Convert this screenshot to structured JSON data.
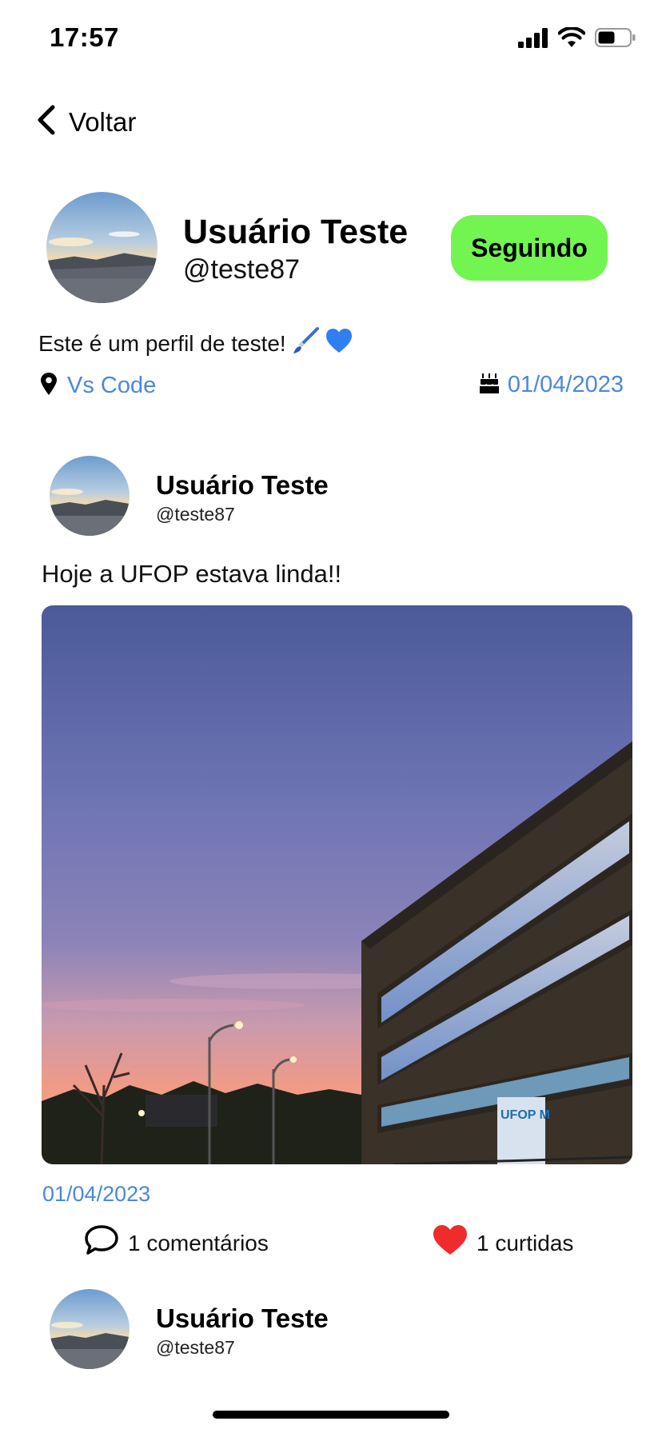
{
  "status_bar": {
    "time": "17:57"
  },
  "nav": {
    "back_label": "Voltar"
  },
  "profile": {
    "name": "Usuário Teste",
    "handle": "@teste87",
    "follow_label": "Seguindo",
    "bio": "Este é um perfil de teste!",
    "bio_emoji": [
      "paintbrush",
      "blue-heart"
    ],
    "location": "Vs Code",
    "joined_date": "01/04/2023"
  },
  "posts": [
    {
      "author_name": "Usuário Teste",
      "author_handle": "@teste87",
      "text": "Hoje a UFOP estava linda!!",
      "date": "01/04/2023",
      "comments_label": "1 comentários",
      "likes_label": "1 curtidas"
    },
    {
      "author_name": "Usuário Teste",
      "author_handle": "@teste87"
    }
  ],
  "colors": {
    "accent_blue": "#4a87e0",
    "follow_green": "#72f551",
    "like_red": "#ef2b2b"
  }
}
